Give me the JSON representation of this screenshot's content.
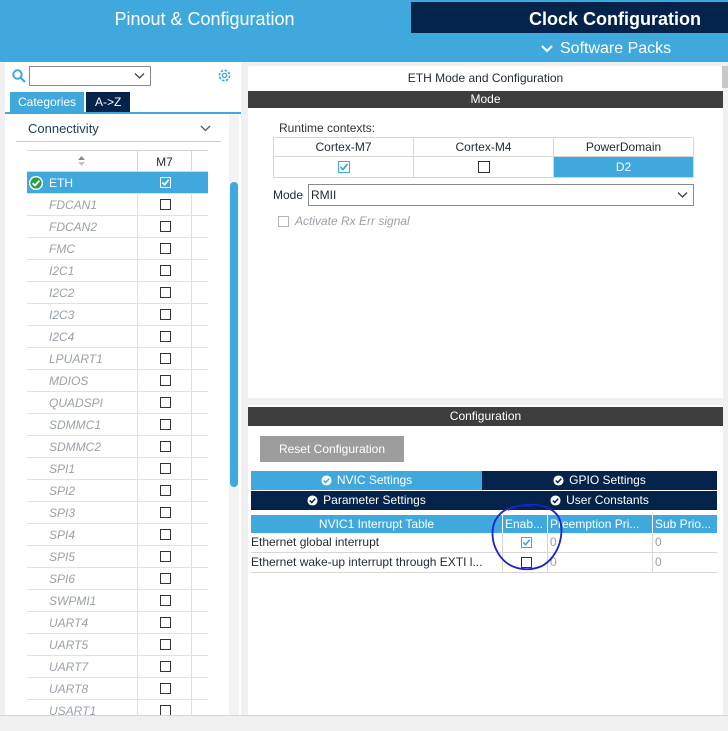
{
  "header": {
    "tab_pinout": "Pinout & Configuration",
    "tab_clock": "Clock Configuration",
    "software_packs": "Software Packs"
  },
  "left": {
    "search_value": "",
    "tab_categories": "Categories",
    "tab_az": "A->Z",
    "category": "Connectivity",
    "column_m7": "M7",
    "peripherals": [
      {
        "name": "ETH",
        "checked": true,
        "selected": true
      },
      {
        "name": "FDCAN1",
        "checked": false
      },
      {
        "name": "FDCAN2",
        "checked": false
      },
      {
        "name": "FMC",
        "checked": false
      },
      {
        "name": "I2C1",
        "checked": false
      },
      {
        "name": "I2C2",
        "checked": false
      },
      {
        "name": "I2C3",
        "checked": false
      },
      {
        "name": "I2C4",
        "checked": false
      },
      {
        "name": "LPUART1",
        "checked": false
      },
      {
        "name": "MDIOS",
        "checked": false
      },
      {
        "name": "QUADSPI",
        "checked": false
      },
      {
        "name": "SDMMC1",
        "checked": false
      },
      {
        "name": "SDMMC2",
        "checked": false
      },
      {
        "name": "SPI1",
        "checked": false
      },
      {
        "name": "SPI2",
        "checked": false
      },
      {
        "name": "SPI3",
        "checked": false
      },
      {
        "name": "SPI4",
        "checked": false
      },
      {
        "name": "SPI5",
        "checked": false
      },
      {
        "name": "SPI6",
        "checked": false
      },
      {
        "name": "SWPMI1",
        "checked": false
      },
      {
        "name": "UART4",
        "checked": false
      },
      {
        "name": "UART5",
        "checked": false
      },
      {
        "name": "UART7",
        "checked": false
      },
      {
        "name": "UART8",
        "checked": false
      },
      {
        "name": "USART1",
        "checked": false
      }
    ]
  },
  "mode_panel": {
    "title": "ETH Mode and Configuration",
    "mode_header": "Mode",
    "runtime_contexts_label": "Runtime contexts:",
    "contexts": [
      {
        "header": "Cortex-M7",
        "checked": true
      },
      {
        "header": "Cortex-M4",
        "checked": false
      },
      {
        "header": "PowerDomain",
        "value": "D2"
      }
    ],
    "mode_label": "Mode",
    "mode_value": "RMII",
    "rx_err_label": "Activate Rx Err signal"
  },
  "config_panel": {
    "header": "Configuration",
    "reset_button": "Reset Configuration",
    "tabs_row1": [
      {
        "label": "NVIC Settings",
        "active": true
      },
      {
        "label": "GPIO Settings",
        "active": false
      }
    ],
    "tabs_row2": [
      {
        "label": "Parameter Settings",
        "active": false
      },
      {
        "label": "User Constants",
        "active": false
      }
    ],
    "nvic_columns": [
      "NVIC1 Interrupt Table",
      "Enab...",
      "Preemption Pri...",
      "Sub Prio..."
    ],
    "nvic_rows": [
      {
        "name": "Ethernet global interrupt",
        "enabled": true,
        "preemption": "0",
        "sub": "0"
      },
      {
        "name": "Ethernet wake-up interrupt through EXTI l...",
        "enabled": false,
        "preemption": "0",
        "sub": "0"
      }
    ]
  },
  "colors": {
    "accent_blue": "#3fa9dd",
    "dark_navy": "#03234b",
    "section_bar": "#3e3e3e",
    "annotation_ink": "#1a22c8"
  }
}
